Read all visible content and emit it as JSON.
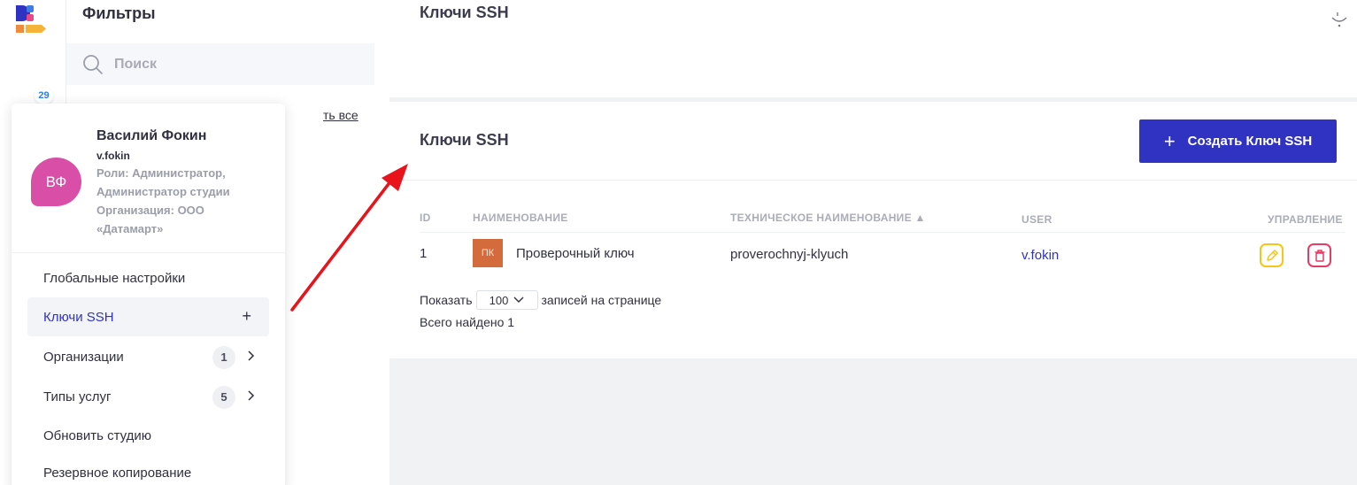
{
  "sidebar": {
    "rail_badge": "29"
  },
  "filters": {
    "title": "Фильтры",
    "search_placeholder": "Поиск",
    "show_all": "ть все"
  },
  "page": {
    "title": "Ключи SSH"
  },
  "card": {
    "title": "Ключи SSH",
    "create_label": "Создать Ключ SSH",
    "create_icon": "+",
    "columns": [
      "ID",
      "НАИМЕНОВАНИЕ",
      "ТЕХНИЧЕСКОЕ НАИМЕНОВАНИЕ  ▲",
      "USER",
      "УПРАВЛЕНИЕ"
    ],
    "rows": [
      {
        "id": "1",
        "badge": "ПК",
        "name": "Проверочный ключ",
        "tech_name": "proverochnyj-klyuch",
        "user": "v.fokin"
      }
    ],
    "show_label": "Показать",
    "per_page": "100",
    "per_page_suffix": "записей на странице",
    "total": "Всего найдено 1"
  },
  "user_menu": {
    "avatar": "ВФ",
    "name": "Василий Фокин",
    "login": "v.fokin",
    "roles": "Роли: Администратор, Администратор студии Организация: ООО «Датамарт»",
    "items": [
      {
        "label": "Глобальные настройки"
      },
      {
        "label": "Ключи SSH",
        "active": true,
        "action": "+"
      },
      {
        "label": "Организации",
        "count": "1"
      },
      {
        "label": "Типы услуг",
        "count": "5"
      },
      {
        "label": "Обновить студию"
      },
      {
        "label": "Резервное копирование"
      }
    ]
  },
  "colors": {
    "primary": "#3033c2",
    "edit": "#f5c518",
    "delete": "#e33c66",
    "avatar": "#d94fa8",
    "arrow": "#e8131b"
  }
}
